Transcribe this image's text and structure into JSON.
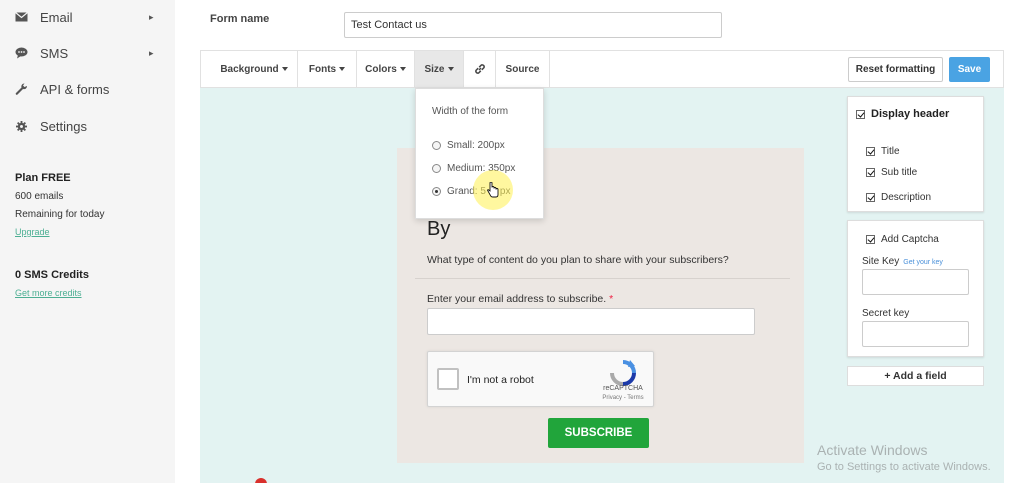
{
  "sidebar": {
    "items": [
      {
        "label": "Email",
        "icon": "envelope-icon",
        "has_chevron": true
      },
      {
        "label": "SMS",
        "icon": "chat-bubble-icon",
        "has_chevron": true
      },
      {
        "label": "API & forms",
        "icon": "wrench-icon",
        "has_chevron": false
      },
      {
        "label": "Settings",
        "icon": "gear-icon",
        "has_chevron": false
      }
    ],
    "plan": {
      "title": "Plan FREE",
      "emails": "600 emails",
      "remaining": "Remaining for today",
      "upgrade": "Upgrade"
    },
    "sms": {
      "credits": "0 SMS Credits",
      "get_more": "Get more credits"
    }
  },
  "header": {
    "form_name_label": "Form name",
    "form_name_value": "Test Contact us"
  },
  "toolbar": {
    "background": "Background",
    "fonts": "Fonts",
    "colors": "Colors",
    "size": "Size",
    "source": "Source",
    "reset": "Reset formatting",
    "save": "Save"
  },
  "size_dropdown": {
    "title": "Width of the form",
    "options": [
      {
        "label": "Small: 200px",
        "checked": false
      },
      {
        "label": "Medium: 350px",
        "checked": false
      },
      {
        "label": "Grand: 5",
        "suffix": "px",
        "checked": true
      }
    ]
  },
  "form_preview": {
    "title_partial": "tter",
    "subtitle": "By",
    "description": "What type of content do you plan to share with your subscribers?",
    "email_label": "Enter your email address to subscribe.",
    "required_mark": "*",
    "captcha_text": "I'm not a robot",
    "captcha_brand": "reCAPTCHA",
    "captcha_links": "Privacy - Terms",
    "subscribe": "SUBSCRIBE"
  },
  "right_panel": {
    "display_header": "Display header",
    "title": "Title",
    "sub_title": "Sub title",
    "description": "Description",
    "add_captcha": "Add Captcha",
    "site_key": "Site Key",
    "get_your_key": "Get your key",
    "secret_key": "Secret key",
    "add_field": "+ Add a field"
  },
  "watermark": {
    "line1": "Activate Windows",
    "line2": "Go to Settings to activate Windows."
  },
  "colors": {
    "save_button": "#4aa3e3",
    "subscribe_button": "#21a53b",
    "canvas_bg": "#e3f3f2",
    "link": "#4caf93"
  }
}
